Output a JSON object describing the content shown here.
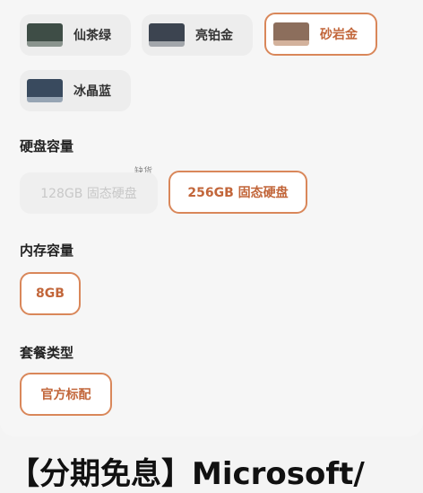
{
  "colors": {
    "options": [
      {
        "label": "仙茶绿",
        "screen": "#3e4d46",
        "base": "#8a948e",
        "selected": false
      },
      {
        "label": "亮铂金",
        "screen": "#3c4450",
        "base": "#a2a6ab",
        "selected": false
      },
      {
        "label": "砂岩金",
        "screen": "#8c6e5c",
        "base": "#d3b29c",
        "selected": true
      },
      {
        "label": "冰晶蓝",
        "screen": "#394a5e",
        "base": "#97a5b4",
        "selected": false
      }
    ]
  },
  "storage": {
    "title": "硬盘容量",
    "out_of_stock_tag": "缺货",
    "options": [
      {
        "label": "128GB 固态硬盘",
        "state": "disabled"
      },
      {
        "label": "256GB 固态硬盘",
        "state": "selected"
      }
    ]
  },
  "memory": {
    "title": "内存容量",
    "options": [
      {
        "label": "8GB",
        "state": "selected"
      }
    ]
  },
  "package": {
    "title": "套餐类型",
    "options": [
      {
        "label": "官方标配",
        "state": "selected"
      }
    ]
  },
  "product": {
    "title": "【分期免息】Microsoft/"
  }
}
